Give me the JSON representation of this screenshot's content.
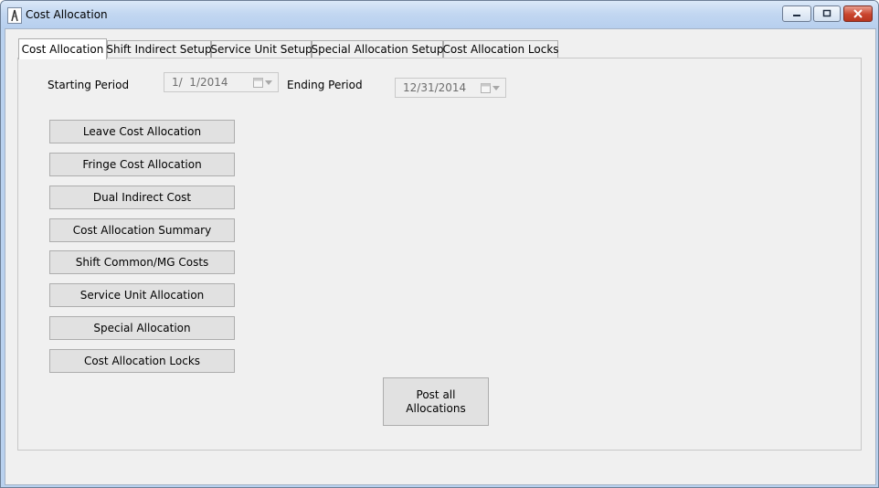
{
  "window": {
    "title": "Cost Allocation",
    "controls": {
      "minimize": "minimize-icon",
      "maximize": "maximize-icon",
      "close": "close-icon"
    }
  },
  "tabs": [
    {
      "label": "Cost Allocation",
      "active": true
    },
    {
      "label": "Shift Indirect Setup",
      "active": false
    },
    {
      "label": "Service Unit Setup",
      "active": false
    },
    {
      "label": "Special Allocation Setup",
      "active": false
    },
    {
      "label": "Cost Allocation Locks",
      "active": false
    }
  ],
  "period": {
    "start_label": "Starting Period",
    "start_value": "1/  1/2014",
    "end_label": "Ending Period",
    "end_value": "12/31/2014"
  },
  "buttons": [
    "Leave Cost Allocation",
    "Fringe Cost Allocation",
    "Dual Indirect Cost",
    "Cost Allocation Summary",
    "Shift Common/MG Costs",
    "Service Unit Allocation",
    "Special Allocation",
    "Cost Allocation Locks"
  ],
  "post_button": {
    "line1": "Post all",
    "line2": "Allocations"
  }
}
